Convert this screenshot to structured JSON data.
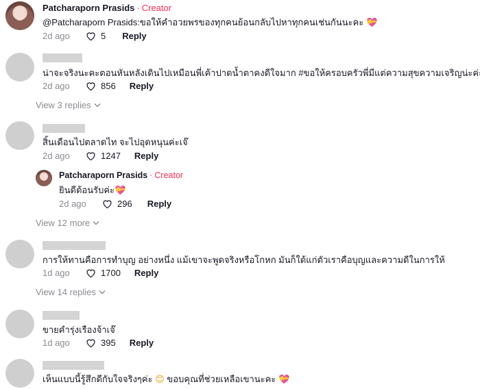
{
  "comments": [
    {
      "author": "Patcharaporn Prasids",
      "creator_label": "Creator",
      "text": "@Patcharaporn Prasids:ขอให้คำอวยพรของทุกคนย้อนกลับไปหาทุกคนเช่นกันนะคะ",
      "emoji": "💝",
      "date": "2d ago",
      "likes": "5",
      "reply": "Reply"
    },
    {
      "text": "น่าจะจริงนะคะตอนหันหลังเดินไปเหมือนพี่เค้าปาดน้ำตาคงดีใจมาก #ขอให้ครอบครัวพี่มีแต่ความสุขความเจริญน่ะค่ะ",
      "date": "2d ago",
      "likes": "856",
      "reply": "Reply",
      "view_replies": "View 3 replies"
    },
    {
      "text": "สิ้นเดือนไปตลาดไท จะไปอุดหนุนค่ะเจ๊",
      "date": "2d ago",
      "likes": "1247",
      "reply": "Reply",
      "view_replies": "View 12 more",
      "sub_reply": {
        "author": "Patcharaporn Prasids",
        "creator_label": "Creator",
        "text": "ยินดีต้อนรับค่ะ",
        "emoji": "💝",
        "date": "2d ago",
        "likes": "296",
        "reply": "Reply"
      }
    },
    {
      "text": "การให้ทานคือการทำบุญ อย่างหนึ่ง แม้เขาจะพูดจริงหรือโกหก มันก็ใด้แก่ตัวเราคือบุญและความดีในการให้",
      "date": "1d ago",
      "likes": "1700",
      "reply": "Reply",
      "view_replies": "View 14 replies"
    },
    {
      "text": "ขายคำรุ่งเรืองจ้าเจ๊",
      "date": "1d ago",
      "likes": "395",
      "reply": "Reply"
    },
    {
      "text": "เห็นแบบนี้รู้สึกดีกับใจจริงๆค่ะ",
      "emoji": "😊",
      "text2": "ขอบคุณที่ช่วยเหลือเขานะคะ",
      "emoji2": "💝"
    }
  ],
  "icons": {
    "like": "heart-outline-icon",
    "expand": "chevron-down-icon"
  },
  "colors": {
    "creator": "#fe2c55",
    "muted": "#8a8b91",
    "text": "#161823"
  }
}
